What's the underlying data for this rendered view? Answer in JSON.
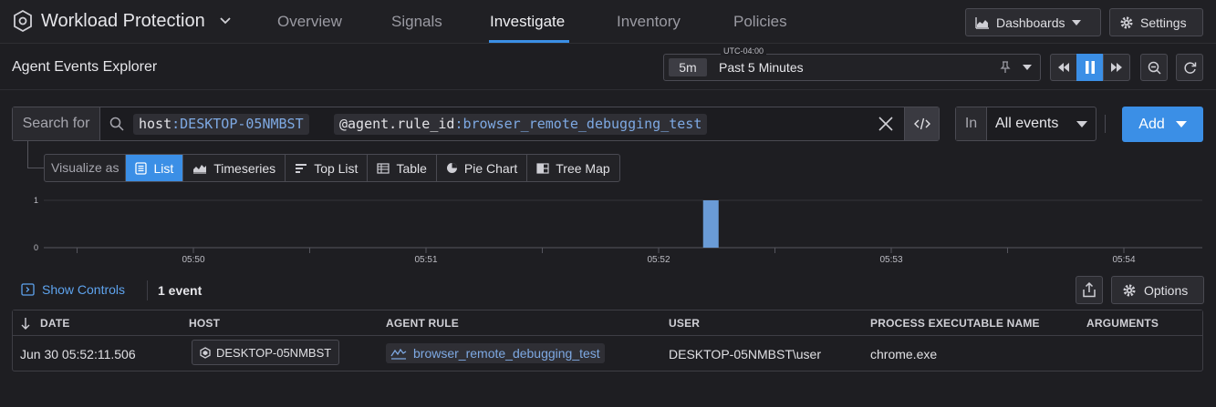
{
  "nav": {
    "product": "Workload Protection",
    "tabs": [
      "Overview",
      "Signals",
      "Investigate",
      "Inventory",
      "Policies"
    ],
    "active_tab": "Investigate",
    "dashboards_label": "Dashboards",
    "settings_label": "Settings"
  },
  "subheader": {
    "title": "Agent Events Explorer",
    "timezone": "UTC-04:00",
    "time_badge": "5m",
    "time_range": "Past 5 Minutes"
  },
  "search": {
    "label": "Search for",
    "terms": [
      {
        "key": "host",
        "sep": ":",
        "value": "DESKTOP-05NMBST"
      },
      {
        "key": "@agent.rule_id",
        "sep": ":",
        "value": "browser_remote_debugging_test"
      }
    ],
    "in_label": "In",
    "in_value": "All events",
    "add_label": "Add"
  },
  "visualize": {
    "label": "Visualize as",
    "options": [
      {
        "label": "List",
        "icon": "list-icon",
        "active": true
      },
      {
        "label": "Timeseries",
        "icon": "timeseries-icon",
        "active": false
      },
      {
        "label": "Top List",
        "icon": "toplist-icon",
        "active": false
      },
      {
        "label": "Table",
        "icon": "table-icon",
        "active": false
      },
      {
        "label": "Pie Chart",
        "icon": "pie-chart-icon",
        "active": false
      },
      {
        "label": "Tree Map",
        "icon": "tree-map-icon",
        "active": false
      }
    ]
  },
  "chart_data": {
    "type": "bar",
    "title": "",
    "xlabel": "",
    "ylabel": "",
    "y_ticks": [
      "1",
      "0"
    ],
    "ylim": [
      0,
      1
    ],
    "x_ticks": [
      "05:50",
      "05:51",
      "05:52",
      "05:53",
      "05:54"
    ],
    "series": [
      {
        "x": [
          "05:52:11"
        ],
        "values": [
          1
        ],
        "color": "#6a9bd6"
      }
    ]
  },
  "controls": {
    "show_controls_label": "Show Controls",
    "event_count": "1 event",
    "options_label": "Options"
  },
  "table": {
    "columns": [
      "DATE",
      "HOST",
      "AGENT RULE",
      "USER",
      "PROCESS EXECUTABLE NAME",
      "ARGUMENTS"
    ],
    "rows": [
      {
        "date": "Jun 30 05:52:11.506",
        "host": "DESKTOP-05NMBST",
        "agent_rule": "browser_remote_debugging_test",
        "user": "DESKTOP-05NMBST\\user",
        "process": "chrome.exe",
        "arguments": ""
      }
    ]
  },
  "colors": {
    "accent": "#3b8fe6",
    "bar": "#6a9bd6",
    "link": "#5ea3ee"
  }
}
